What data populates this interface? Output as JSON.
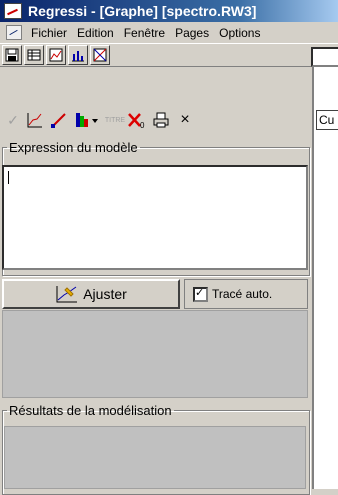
{
  "window": {
    "title": "Regressi  - [Graphe] [spectro.RW3]"
  },
  "menu": {
    "items": [
      "Fichier",
      "Edition",
      "Fenêtre",
      "Pages",
      "Options"
    ]
  },
  "toolbar2": {
    "close_label": "×",
    "curve_field": "Cu"
  },
  "model_panel": {
    "legend": "Expression du modèle",
    "expression_value": "",
    "ajuster_label": "Ajuster",
    "trace_auto_label": "Tracé auto.",
    "trace_auto_checked": true
  },
  "results_panel": {
    "legend": "Résultats de la modélisation"
  },
  "colors": {
    "title_active": "#0a246a",
    "panel_grey": "#c0c0c0",
    "face": "#d4d0c8"
  }
}
